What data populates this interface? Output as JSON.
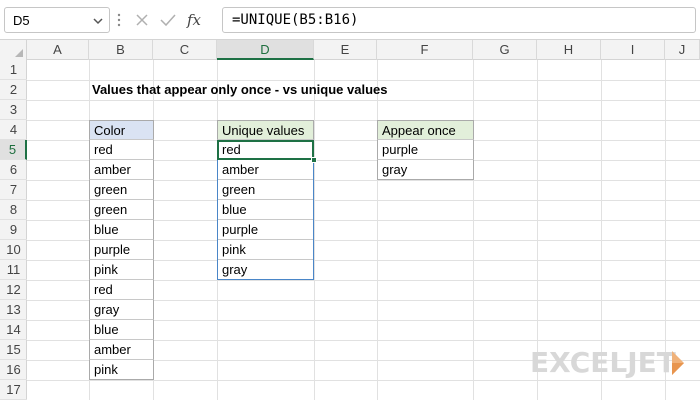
{
  "formula_bar": {
    "name_box": "D5",
    "fx_label": "fx",
    "formula": "=UNIQUE(B5:B16)"
  },
  "columns": [
    "A",
    "B",
    "C",
    "D",
    "E",
    "F",
    "G",
    "H",
    "I",
    "J"
  ],
  "rows": [
    "1",
    "2",
    "3",
    "4",
    "5",
    "6",
    "7",
    "8",
    "9",
    "10",
    "11",
    "12",
    "13",
    "14",
    "15",
    "16",
    "17"
  ],
  "sheet": {
    "title": "Values that appear only once - vs unique values",
    "color_table": {
      "header": "Color",
      "values": [
        "red",
        "amber",
        "green",
        "green",
        "blue",
        "purple",
        "pink",
        "red",
        "gray",
        "blue",
        "amber",
        "pink"
      ]
    },
    "unique_table": {
      "header": "Unique values",
      "values": [
        "red",
        "amber",
        "green",
        "blue",
        "purple",
        "pink",
        "gray"
      ]
    },
    "once_table": {
      "header": "Appear once",
      "values": [
        "purple",
        "gray"
      ]
    }
  },
  "logo": {
    "text": "EXCELJET"
  },
  "colors": {
    "accent": "#1e7145",
    "header_blue": "#dae3f3",
    "header_green": "#e2efda",
    "spill_border": "#4a86c8"
  },
  "icons": [
    "chevron-down-icon",
    "cancel-icon",
    "check-icon",
    "function-icon",
    "exceljet-logo-icon"
  ]
}
